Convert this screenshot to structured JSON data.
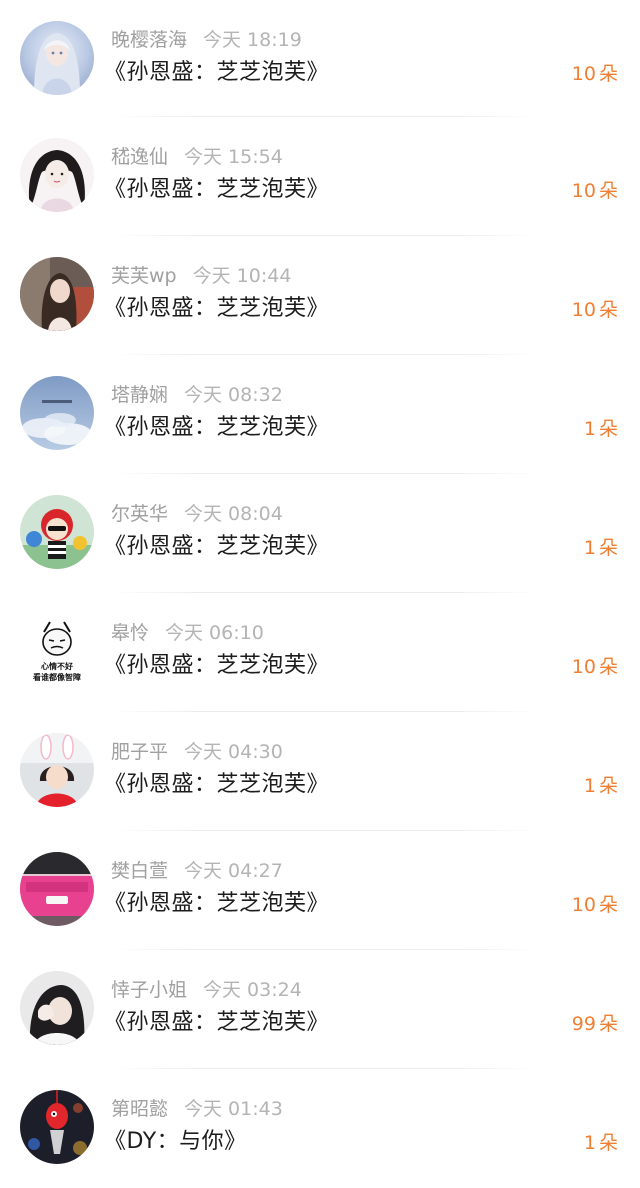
{
  "colors": {
    "username": "#a0a0a0",
    "time": "#b4b4b4",
    "message": "#1c1c1c",
    "gift": "#f07f34",
    "divider": "#ececec"
  },
  "gift_unit": "朵",
  "items": [
    {
      "username": "晚樱落海",
      "time": "今天 18:19",
      "message": "《孙恩盛：芝芝泡芙》",
      "gift_count": "10",
      "avatar": "anime-girl-avatar"
    },
    {
      "username": "嵇逸仙",
      "time": "今天 15:54",
      "message": "《孙恩盛：芝芝泡芙》",
      "gift_count": "10",
      "avatar": "curly-hair-girl-avatar"
    },
    {
      "username": "芙芙wp",
      "time": "今天 10:44",
      "message": "《孙恩盛：芝芝泡芙》",
      "gift_count": "10",
      "avatar": "girl-photo-avatar"
    },
    {
      "username": "塔静娴",
      "time": "今天 08:32",
      "message": "《孙恩盛：芝芝泡芙》",
      "gift_count": "1",
      "avatar": "sky-clouds-avatar"
    },
    {
      "username": "尔英华",
      "time": "今天 08:04",
      "message": "《孙恩盛：芝芝泡芙》",
      "gift_count": "1",
      "avatar": "toy-figure-avatar"
    },
    {
      "username": "皋怜",
      "time": "今天 06:10",
      "message": "《孙恩盛：芝芝泡芙》",
      "gift_count": "10",
      "avatar": "meme-face-avatar"
    },
    {
      "username": "肥子平",
      "time": "今天 04:30",
      "message": "《孙恩盛：芝芝泡芙》",
      "gift_count": "1",
      "avatar": "child-bunny-ears-avatar"
    },
    {
      "username": "樊白萱",
      "time": "今天 04:27",
      "message": "《孙恩盛：芝芝泡芙》",
      "gift_count": "10",
      "avatar": "pink-car-avatar"
    },
    {
      "username": "悻子小姐",
      "time": "今天 03:24",
      "message": "《孙恩盛：芝芝泡芙》",
      "gift_count": "99",
      "avatar": "girl-hiding-face-avatar"
    },
    {
      "username": "第昭懿",
      "time": "今天 01:43",
      "message": "《DY：与你》",
      "gift_count": "1",
      "avatar": "night-lantern-avatar"
    }
  ],
  "meme_caption_1": "心情不好",
  "meme_caption_2": "看谁都像智障"
}
